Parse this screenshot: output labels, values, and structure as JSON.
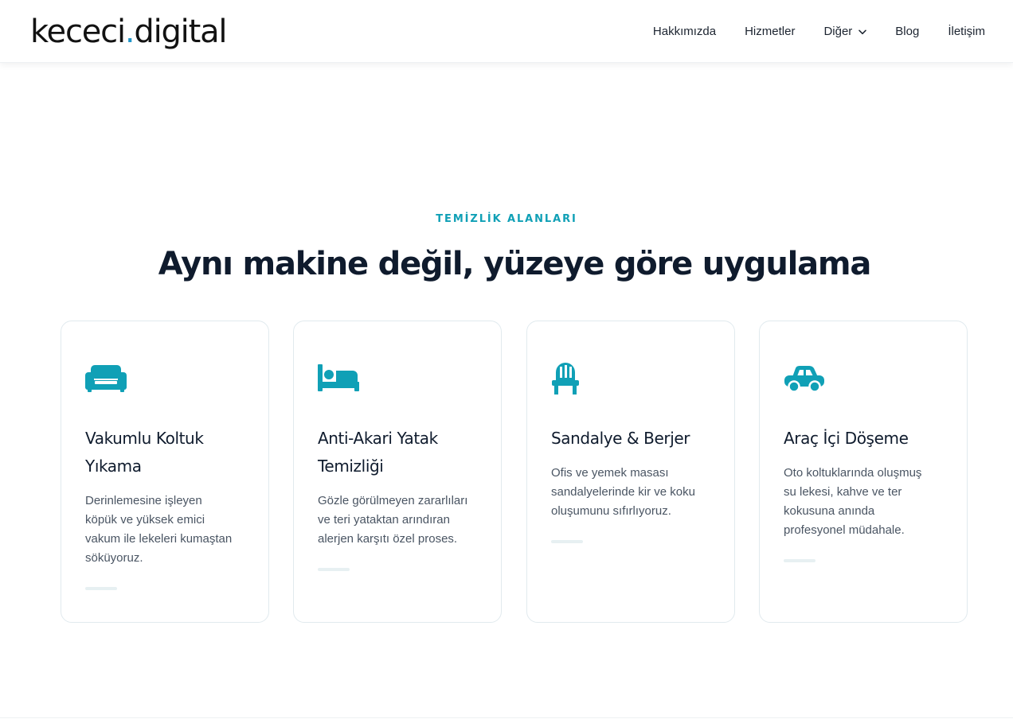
{
  "header": {
    "logo_main": "kececi",
    "logo_dot": ".",
    "logo_suffix": "digital",
    "nav": [
      {
        "label": "Hakkımızda"
      },
      {
        "label": "Hizmetler"
      },
      {
        "label": "Diğer"
      },
      {
        "label": "Blog"
      },
      {
        "label": "İletişim"
      }
    ]
  },
  "section": {
    "eyebrow": "TEMİZLİK ALANLARI",
    "headline": "Aynı makine değil, yüzeye göre uygulama",
    "cards": [
      {
        "icon": "couch-icon",
        "title_line1": "Vakumlu Koltuk",
        "title_line2": "Yıkama",
        "desc_lines": [
          "Derinlemesine işleyen",
          "köpük ve yüksek emici",
          "vakum ile lekeleri kumaştan",
          "söküyoruz."
        ]
      },
      {
        "icon": "bed-icon",
        "title_line1": "Anti-Akari Yatak",
        "title_line2": "Temizliği",
        "desc_lines": [
          "Gözle görülmeyen zararlıları",
          "ve teri yataktan arındıran",
          "alerjen karşıtı özel proses."
        ]
      },
      {
        "icon": "chair-icon",
        "title_line1": "Sandalye & Berjer",
        "title_line2": "",
        "desc_lines": [
          "Ofis ve yemek masası",
          "sandalyelerinde kir ve koku",
          "oluşumunu sıfırlıyoruz."
        ]
      },
      {
        "icon": "car-icon",
        "title_line1": "Araç İçi Döşeme",
        "title_line2": "",
        "desc_lines": [
          "Oto koltuklarında oluşmuş",
          "su lekesi, kahve ve ter",
          "kokusuna anında",
          "profesyonel müdahale."
        ]
      }
    ]
  },
  "colors": {
    "accent": "#10a0b6",
    "logo_dot": "#2196c9",
    "heading": "#0f1b2d",
    "body_text": "#4a5563",
    "card_border": "#e1eaee"
  }
}
